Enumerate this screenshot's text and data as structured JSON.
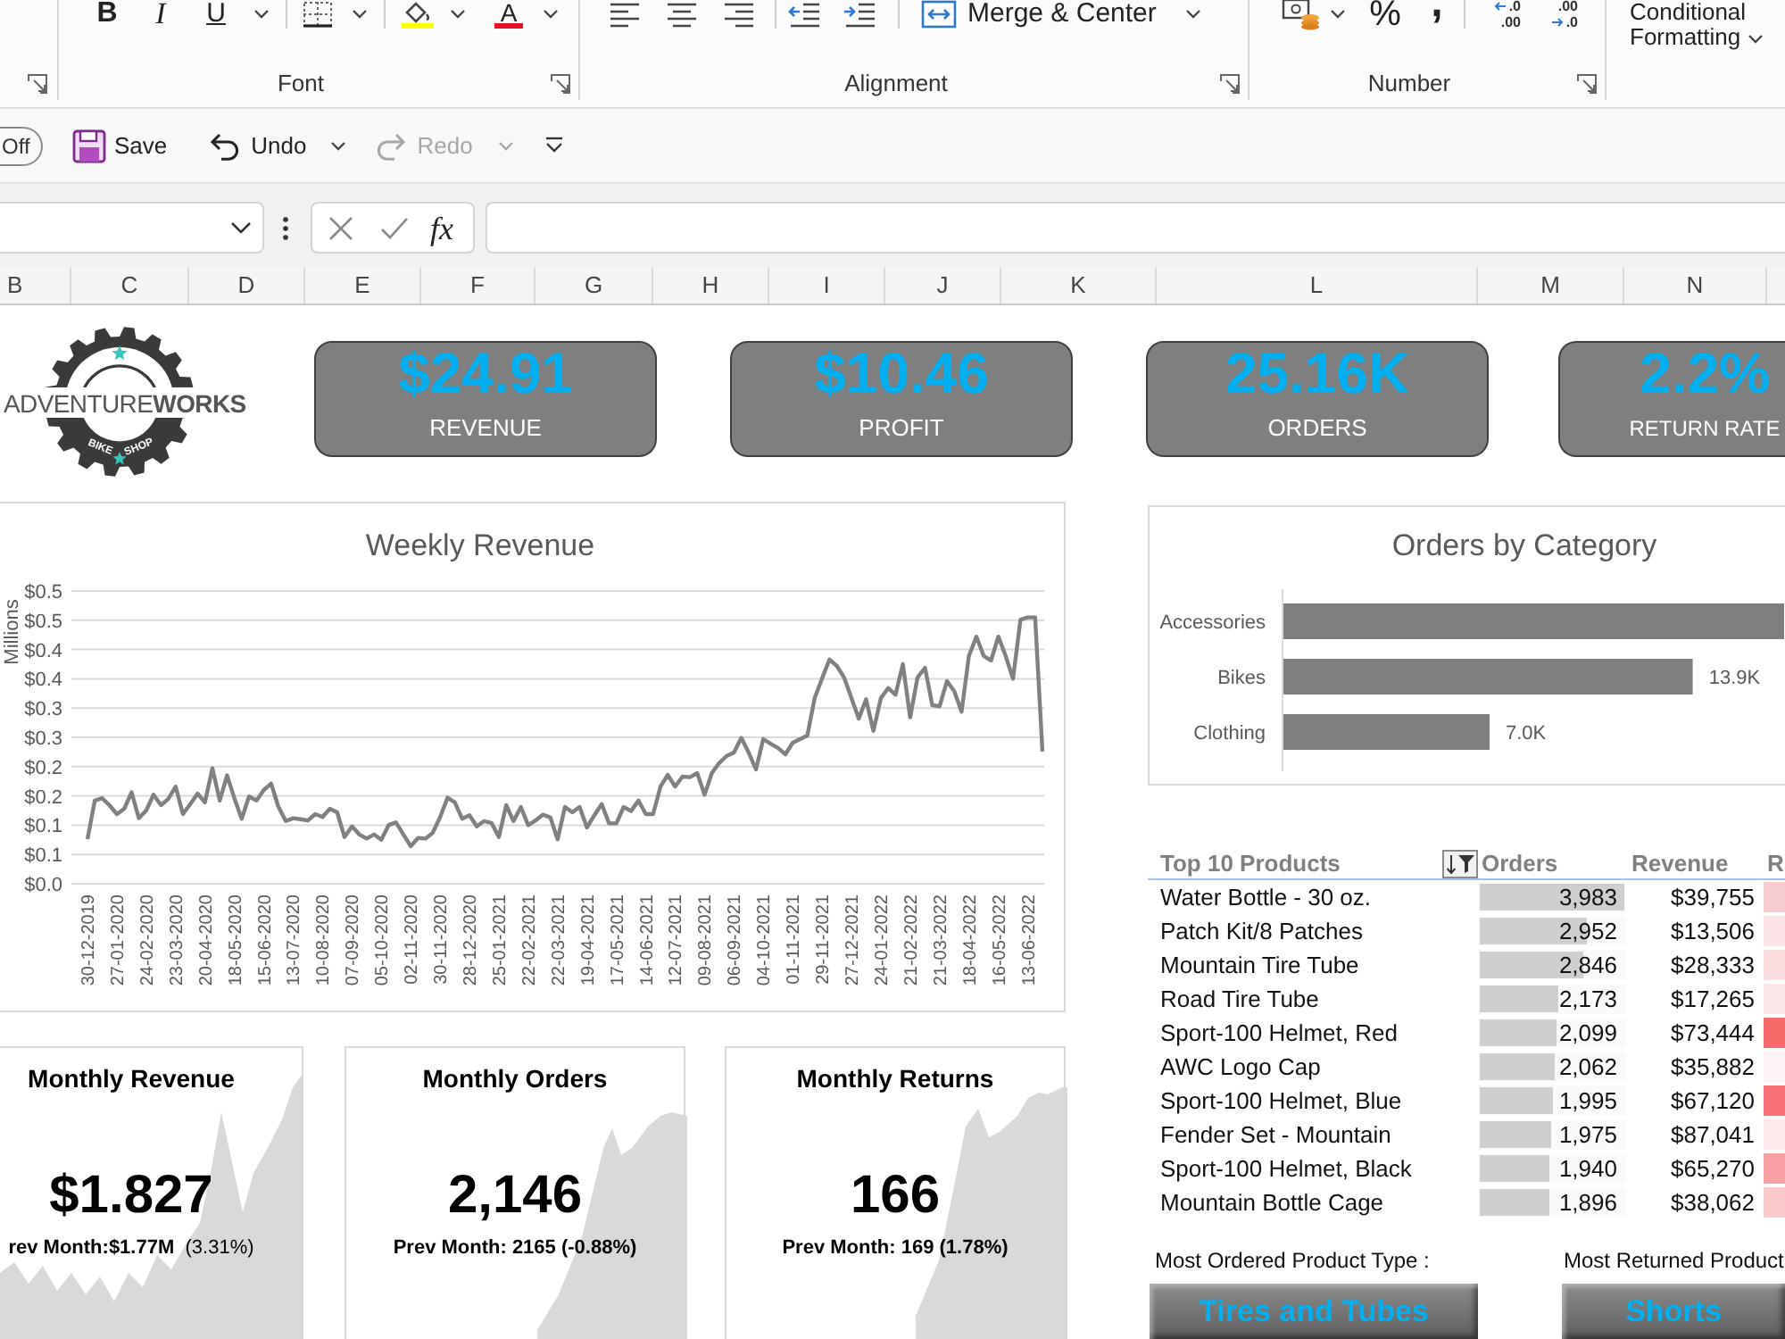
{
  "ribbon": {
    "font_group": {
      "label": "Font",
      "bold": "B",
      "italic": "I",
      "underline": "U",
      "font_color": "A"
    },
    "alignment_group": {
      "label": "Alignment",
      "merge": "Merge & Center"
    },
    "number_group": {
      "label": "Number",
      "percent": "%",
      "comma": ",",
      "increase_decimal": [
        ".0",
        ".00"
      ],
      "decrease_decimal": [
        ".00",
        ".0"
      ]
    },
    "conditional_formatting": "Conditional Formatting"
  },
  "quick_access": {
    "autosave": "Off",
    "save": "Save",
    "undo": {
      "label": "Undo",
      "disabled": false
    },
    "redo": {
      "label": "Redo",
      "disabled": true
    }
  },
  "formula_bar": {
    "function_button": "fx"
  },
  "column_headers": [
    "B",
    "C",
    "D",
    "E",
    "F",
    "G",
    "H",
    "I",
    "J",
    "K",
    "L",
    "M",
    "N"
  ],
  "logo": {
    "name": "ADVENTURE**WORKS**",
    "left_word": "BIKE",
    "right_word": "SHOP"
  },
  "kpis": [
    {
      "value": "$24.91",
      "label": "REVENUE"
    },
    {
      "value": "$10.46",
      "label": "PROFIT"
    },
    {
      "value": "25.16K",
      "label": "ORDERS"
    },
    {
      "value": "2.2%",
      "label": "RETURN RATE"
    }
  ],
  "weekly_revenue": {
    "chart_data": {
      "type": "line",
      "title": "Weekly Revenue",
      "ylabel": "Millions",
      "grid": true,
      "ylim": [
        0,
        0.5
      ],
      "yticks": [
        {
          "value": 0,
          "label": "$0.0"
        },
        {
          "value": 0.05,
          "label": "$0.1"
        },
        {
          "value": 0.1,
          "label": "$0.1"
        },
        {
          "value": 0.15,
          "label": "$0.2"
        },
        {
          "value": 0.2,
          "label": "$0.2"
        },
        {
          "value": 0.25,
          "label": "$0.3"
        },
        {
          "value": 0.3,
          "label": "$0.3"
        },
        {
          "value": 0.35,
          "label": "$0.4"
        },
        {
          "value": 0.4,
          "label": "$0.4"
        },
        {
          "value": 0.45,
          "label": "$0.5"
        },
        {
          "value": 0.5,
          "label": "$0.5"
        }
      ],
      "categories": [
        "30-12-2019",
        null,
        null,
        null,
        "27-01-2020",
        null,
        null,
        null,
        "24-02-2020",
        null,
        null,
        null,
        "23-03-2020",
        null,
        null,
        null,
        "20-04-2020",
        null,
        null,
        null,
        "18-05-2020",
        null,
        null,
        null,
        "15-06-2020",
        null,
        null,
        null,
        "13-07-2020",
        null,
        null,
        null,
        "10-08-2020",
        null,
        null,
        null,
        "07-09-2020",
        null,
        null,
        null,
        "05-10-2020",
        null,
        null,
        null,
        "02-11-2020",
        null,
        null,
        null,
        "30-11-2020",
        null,
        null,
        null,
        "28-12-2020",
        null,
        null,
        null,
        "25-01-2021",
        null,
        null,
        null,
        "22-02-2021",
        null,
        null,
        null,
        "22-03-2021",
        null,
        null,
        null,
        "19-04-2021",
        null,
        null,
        null,
        "17-05-2021",
        null,
        null,
        null,
        "14-06-2021",
        null,
        null,
        null,
        "12-07-2021",
        null,
        null,
        null,
        "09-08-2021",
        null,
        null,
        null,
        "06-09-2021",
        null,
        null,
        null,
        "04-10-2021",
        null,
        null,
        null,
        "01-11-2021",
        null,
        null,
        null,
        "29-11-2021",
        null,
        null,
        null,
        "27-12-2021",
        null,
        null,
        null,
        "24-01-2022",
        null,
        null,
        null,
        "21-02-2022",
        null,
        null,
        null,
        "21-03-2022",
        null,
        null,
        null,
        "18-04-2022",
        null,
        null,
        null,
        "16-05-2022",
        null,
        null,
        null,
        "13-06-2022",
        null,
        null
      ],
      "values": [
        0.076,
        0.142,
        0.146,
        0.134,
        0.119,
        0.128,
        0.156,
        0.112,
        0.125,
        0.152,
        0.134,
        0.145,
        0.166,
        0.119,
        0.136,
        0.154,
        0.139,
        0.197,
        0.142,
        0.185,
        0.146,
        0.111,
        0.149,
        0.142,
        0.16,
        0.171,
        0.131,
        0.107,
        0.112,
        0.11,
        0.108,
        0.119,
        0.114,
        0.128,
        0.122,
        0.08,
        0.098,
        0.084,
        0.077,
        0.084,
        0.075,
        0.1,
        0.105,
        0.084,
        0.064,
        0.078,
        0.077,
        0.087,
        0.113,
        0.147,
        0.139,
        0.111,
        0.117,
        0.098,
        0.107,
        0.104,
        0.08,
        0.134,
        0.107,
        0.131,
        0.1,
        0.108,
        0.118,
        0.113,
        0.076,
        0.131,
        0.122,
        0.131,
        0.096,
        0.117,
        0.136,
        0.103,
        0.103,
        0.131,
        0.124,
        0.142,
        0.119,
        0.119,
        0.166,
        0.186,
        0.166,
        0.183,
        0.182,
        0.189,
        0.152,
        0.189,
        0.206,
        0.218,
        0.224,
        0.249,
        0.224,
        0.195,
        0.247,
        0.239,
        0.232,
        0.221,
        0.241,
        0.247,
        0.253,
        0.317,
        0.35,
        0.383,
        0.372,
        0.352,
        0.317,
        0.282,
        0.315,
        0.261,
        0.317,
        0.334,
        0.323,
        0.375,
        0.284,
        0.352,
        0.369,
        0.305,
        0.303,
        0.346,
        0.329,
        0.294,
        0.389,
        0.422,
        0.389,
        0.381,
        0.422,
        0.389,
        0.35,
        0.451,
        0.455,
        0.455,
        0.226
      ]
    }
  },
  "orders_by_category": {
    "chart_data": {
      "type": "bar",
      "orientation": "horizontal",
      "title": "Orders by Category",
      "categories": [
        "Accessories",
        "Bikes",
        "Clothing"
      ],
      "values": [
        17.0,
        13.9,
        7.0
      ],
      "value_labels": [
        null,
        "13.9K",
        "7.0K"
      ]
    }
  },
  "top_products": {
    "columns": [
      "Top 10 Products",
      "Orders",
      "Revenue",
      "R"
    ],
    "rows": [
      {
        "product": "Water Bottle - 30 oz.",
        "orders": "3,983",
        "level": 1,
        "revenue": "$39,755",
        "color": "#f9cdd0"
      },
      {
        "product": "Patch Kit/8 Patches",
        "orders": "2,952",
        "level": 0.741,
        "revenue": "$13,506",
        "color": "#fce4e6"
      },
      {
        "product": "Mountain Tire Tube",
        "orders": "2,846",
        "level": 0.715,
        "revenue": "$28,333",
        "color": "#fbdde0"
      },
      {
        "product": "Road Tire Tube",
        "orders": "2,173",
        "level": 0.546,
        "revenue": "$17,265",
        "color": "#fce5e7"
      },
      {
        "product": "Sport-100 Helmet, Red",
        "orders": "2,099",
        "level": 0.527,
        "revenue": "$73,444",
        "color": "#f8696b"
      },
      {
        "product": "AWC Logo Cap",
        "orders": "2,062",
        "level": 0.518,
        "revenue": "$35,882",
        "color": "#fdf3f4"
      },
      {
        "product": "Sport-100 Helmet, Blue",
        "orders": "1,995",
        "level": 0.501,
        "revenue": "$67,120",
        "color": "#f87174"
      },
      {
        "product": "Fender Set - Mountain",
        "orders": "1,975",
        "level": 0.496,
        "revenue": "$87,041",
        "color": "#fde9eb"
      },
      {
        "product": "Sport-100 Helmet, Black",
        "orders": "1,940",
        "level": 0.487,
        "revenue": "$65,270",
        "color": "#f9a0a2"
      },
      {
        "product": "Mountain Bottle Cage",
        "orders": "1,896",
        "level": 0.476,
        "revenue": "$38,062",
        "color": "#fbc8ca"
      }
    ]
  },
  "monthly_cards": [
    {
      "title": "Monthly Revenue",
      "value": "$1.827",
      "comparison": "**rev Month:$1.77M**  (3.31%)",
      "bold": false
    },
    {
      "title": "Monthly Orders",
      "value": "2,146",
      "comparison": "Prev Month: 2165 (-0.88%)",
      "bold": true
    },
    {
      "title": "Monthly Returns",
      "value": "166",
      "comparison": "Prev Month: 169 (1.78%)",
      "bold": true
    }
  ],
  "most_ordered": {
    "label": "Most Ordered Product Type :",
    "value": "Tires and Tubes"
  },
  "most_returned": {
    "label": "Most Returned Product",
    "value": "Shorts"
  }
}
